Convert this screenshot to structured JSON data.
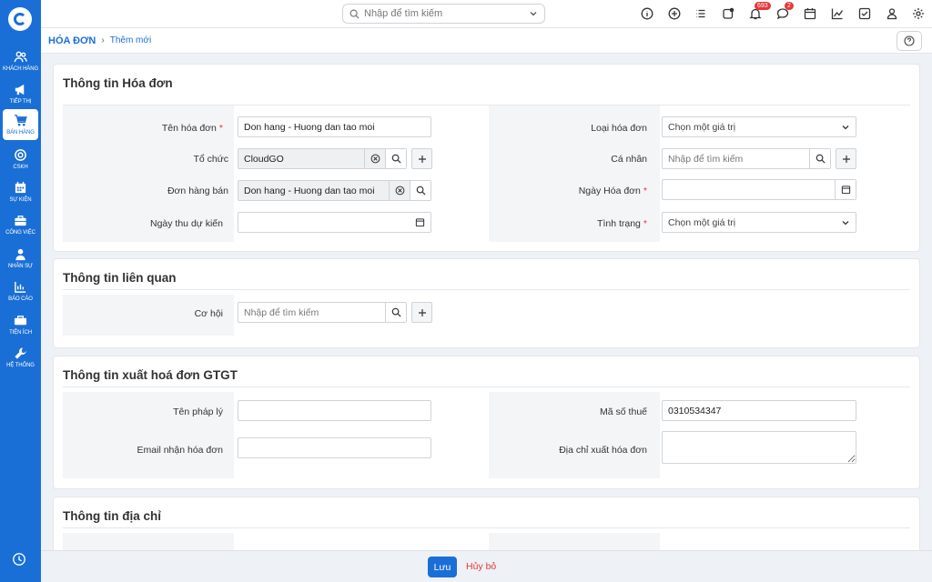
{
  "sidebar": {
    "items": [
      {
        "label": "KHÁCH HÀNG",
        "icon": "users-icon"
      },
      {
        "label": "TIẾP THỊ",
        "icon": "megaphone-icon"
      },
      {
        "label": "BÁN HÀNG",
        "icon": "cart-icon"
      },
      {
        "label": "CSKH",
        "icon": "support-icon"
      },
      {
        "label": "SỰ KIỆN",
        "icon": "calendar-icon"
      },
      {
        "label": "CÔNG VIỆC",
        "icon": "briefcase-icon"
      },
      {
        "label": "NHÂN SỰ",
        "icon": "person-icon"
      },
      {
        "label": "BÁO CÁO",
        "icon": "report-icon"
      },
      {
        "label": "TIỆN ÍCH",
        "icon": "utilities-icon"
      },
      {
        "label": "HỆ THỐNG",
        "icon": "wrench-icon"
      }
    ],
    "active_index": 2
  },
  "topbar": {
    "search_placeholder": "Nhập để tìm kiếm",
    "notification_count": "693",
    "message_count": "2"
  },
  "breadcrumb": {
    "module": "HÓA ĐƠN",
    "page": "Thêm mới"
  },
  "sections": {
    "invoice": {
      "title": "Thông tin Hóa đơn",
      "fields": {
        "name_label": "Tên hóa đơn",
        "name_value": "Don hang - Huong dan tao moi",
        "org_label": "Tổ chức",
        "org_value": "CloudGO",
        "sales_order_label": "Đơn hàng bán",
        "sales_order_value": "Don hang - Huong dan tao moi",
        "expected_date_label": "Ngày thu dự kiến",
        "type_label": "Loại hóa đơn",
        "type_placeholder": "Chọn một giá trị",
        "individual_label": "Cá nhân",
        "individual_placeholder": "Nhập để tìm kiếm",
        "invoice_date_label": "Ngày Hóa đơn",
        "status_label": "Tình trạng",
        "status_placeholder": "Chọn một giá trị"
      }
    },
    "related": {
      "title": "Thông tin liên quan",
      "fields": {
        "opportunity_label": "Cơ hội",
        "opportunity_placeholder": "Nhập để tìm kiếm"
      }
    },
    "vat": {
      "title": "Thông tin xuất hoá đơn GTGT",
      "fields": {
        "legal_name_label": "Tên pháp lý",
        "email_label": "Email nhận hóa đơn",
        "tax_code_label": "Mã số thuế",
        "tax_code_value": "0310534347",
        "address_label": "Địa chỉ xuất hóa đơn"
      }
    },
    "address": {
      "title": "Thông tin địa chỉ"
    }
  },
  "footer": {
    "save_label": "Lưu",
    "cancel_label": "Hủy bỏ"
  },
  "colors": {
    "primary": "#1a6fd6",
    "danger": "#e5373a"
  }
}
